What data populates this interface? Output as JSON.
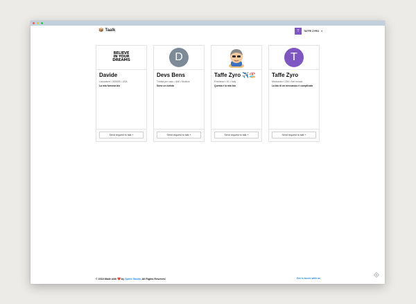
{
  "nav": {
    "brand_icon": "📦",
    "brand": "Taalk",
    "user_initial": "T",
    "user_name": "TAFFE ZYRO",
    "caret": "▾"
  },
  "cards": [
    {
      "name": "Davide",
      "meta": "Lavoratore • 555555 • USA",
      "bio": "La mia fornosa bio",
      "button": "Send request to talk +",
      "logo_lines": [
        "BELIEVE",
        "IN YOUR",
        "DREAMS"
      ]
    },
    {
      "name": "Devs Bens",
      "initial": "D",
      "avatar_color": "#7d8b98",
      "meta": "Turista per caso • 666 • Moldive",
      "bio": "Sono un turista",
      "button": "Send request to talk +"
    },
    {
      "name": "Taffe Zyro ✈️🏖️",
      "meta": "Freelance • 51 • Italy",
      "bio": "Questa è la mia bio",
      "button": "Send request to talk +"
    },
    {
      "name": "Taffe Zyro",
      "initial": "T",
      "avatar_color": "#7e57c2",
      "meta": "Meccanico • 256 • Nel mondo",
      "bio": "La bio di un meccanico è complicata",
      "button": "Send request to talk +"
    }
  ],
  "footer": {
    "prefix": "© 2018 Made with",
    "heart": "❤️",
    "by": "by",
    "studio": "Sprint Studio",
    "suffix": ", All Rights Reserved",
    "contact": "Get in touch with us"
  }
}
